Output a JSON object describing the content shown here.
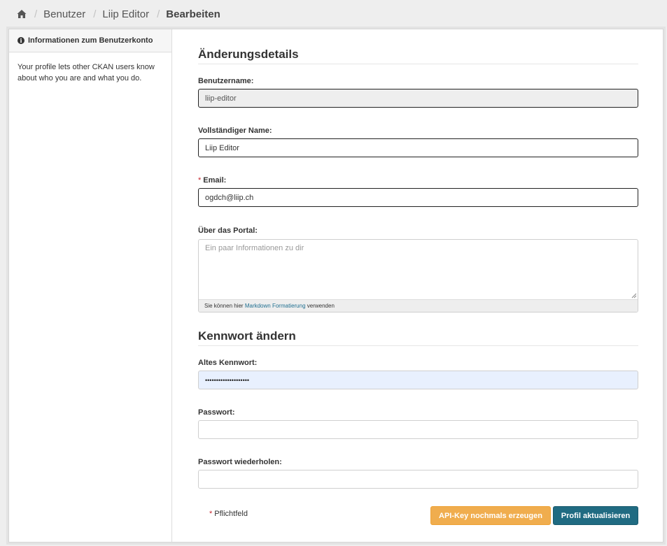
{
  "breadcrumb": {
    "home_icon": "home-icon",
    "items": [
      "Benutzer",
      "Liip Editor"
    ],
    "current": "Bearbeiten"
  },
  "sidebar": {
    "icon": "info-circle-icon",
    "title": "Informationen zum Benutzerkonto",
    "text": "Your profile lets other CKAN users know about who you are and what you do."
  },
  "form": {
    "section_details": "Änderungsdetails",
    "username_label": "Benutzername:",
    "username_value": "liip-editor",
    "fullname_label": "Vollständiger Name:",
    "fullname_value": "Liip Editor",
    "required_mark": "*",
    "email_label": "Email:",
    "email_value": "ogdch@liip.ch",
    "about_label": "Über das Portal:",
    "about_placeholder": "Ein paar Informationen zu dir",
    "markdown_prefix": "Sie können hier",
    "markdown_link": "Markdown Formatierung",
    "markdown_suffix": "verwenden",
    "section_password": "Kennwort ändern",
    "old_password_label": "Altes Kennwort:",
    "old_password_value": "••••••••••••••••••••",
    "password_label": "Passwort:",
    "password_repeat_label": "Passwort wiederholen:",
    "required_note": "Pflichtfeld",
    "api_key_button": "API-Key nochmals erzeugen",
    "update_button": "Profil aktualisieren"
  },
  "colors": {
    "primary": "#206b82",
    "warning": "#f0ad4e",
    "required": "#c6262e"
  }
}
